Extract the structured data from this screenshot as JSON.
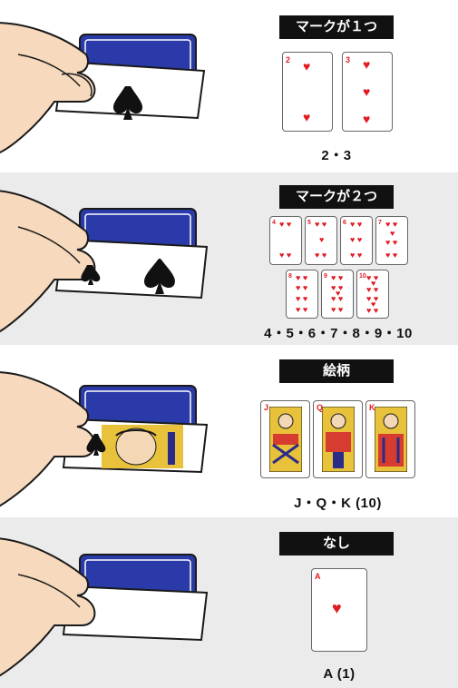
{
  "sections": [
    {
      "label": "マークが１つ",
      "caption": "2・3",
      "background": "white"
    },
    {
      "label": "マークが２つ",
      "caption": "4・5・6・7・8・9・10",
      "background": "gray"
    },
    {
      "label": "絵柄",
      "caption": "J・Q・K (10)",
      "background": "white"
    },
    {
      "label": "なし",
      "caption": "A (1)",
      "background": "gray"
    }
  ],
  "cards": {
    "one_mark": [
      "2",
      "3"
    ],
    "two_marks_row1": [
      "4",
      "5",
      "6",
      "7"
    ],
    "two_marks_row2": [
      "8",
      "9",
      "10"
    ],
    "face": [
      "J",
      "Q",
      "K"
    ],
    "none": [
      "A"
    ]
  },
  "colors": {
    "card_red": "#e21b23",
    "card_back_blue": "#2a3aa8",
    "skin": "#f7d9bd",
    "label_bg": "#111111",
    "panel_gray": "#ebebeb"
  }
}
